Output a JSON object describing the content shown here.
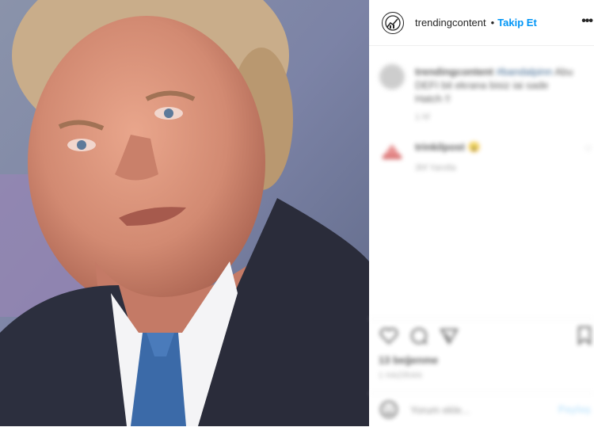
{
  "post": {
    "username": "trendingcontent",
    "separator": "•",
    "follow_label": "Takip Et",
    "more_label": "•••"
  },
  "comment": {
    "user": "trendingcontent",
    "tag": "#bandalpinn",
    "text": "Abu DEFI bit ekrana bisiz iai sade Hatch !!",
    "time": "1 hf"
  },
  "reply": {
    "user": "trinkilpost",
    "emoji": "😮",
    "meta": "3hf Yanıtla"
  },
  "footer": {
    "likes": "13 beğenme",
    "date": "1 HAZİRAN",
    "comment_placeholder": "Yorum ekle...",
    "share_label": "Paylaş"
  },
  "colors": {
    "accent": "#0095f6",
    "text": "#262626",
    "muted": "#8e8e8e"
  }
}
